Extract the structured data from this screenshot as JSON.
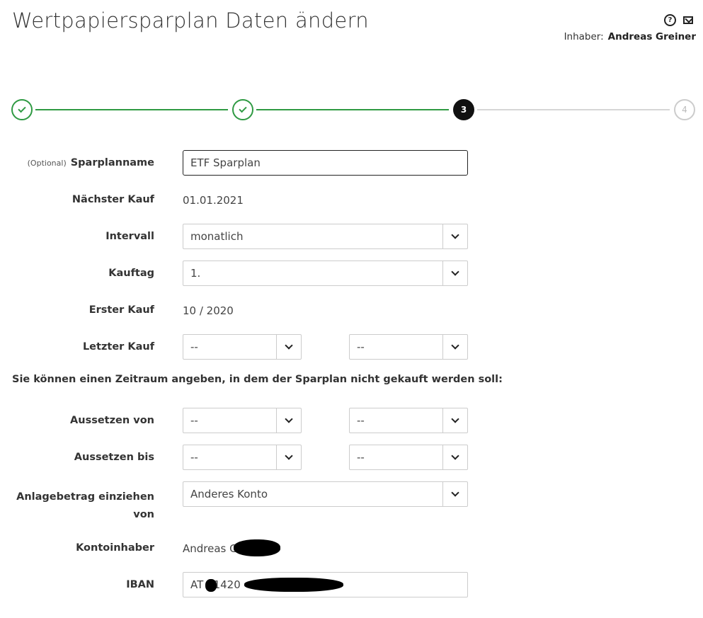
{
  "header": {
    "title": "Wertpapiersparplan Daten ändern",
    "owner_label": "Inhaber:",
    "owner_name": "Andreas Greiner",
    "help_icon_glyph": "?"
  },
  "stepper": {
    "steps": [
      {
        "state": "done",
        "label": ""
      },
      {
        "state": "done",
        "label": ""
      },
      {
        "state": "active",
        "label": "3"
      },
      {
        "state": "todo",
        "label": "4"
      }
    ],
    "colors": {
      "done": "#2f9a43",
      "active": "#111111",
      "todo": "#cccccc"
    }
  },
  "form": {
    "sparplanname": {
      "optional": "(Optional)",
      "label": "Sparplanname",
      "value": "ETF Sparplan"
    },
    "naechster_kauf": {
      "label": "Nächster Kauf",
      "value": "01.01.2021"
    },
    "intervall": {
      "label": "Intervall",
      "value": "monatlich"
    },
    "kauftag": {
      "label": "Kauftag",
      "value": "1."
    },
    "erster_kauf": {
      "label": "Erster Kauf",
      "value": "10 / 2020"
    },
    "letzter_kauf": {
      "label": "Letzter Kauf",
      "month": "--",
      "year": "--"
    },
    "pause_note": "Sie können einen Zeitraum angeben, in dem der Sparplan nicht gekauft werden soll:",
    "aussetzen_von": {
      "label": "Aussetzen von",
      "month": "--",
      "year": "--"
    },
    "aussetzen_bis": {
      "label": "Aussetzen bis",
      "month": "--",
      "year": "--"
    },
    "anlagebetrag": {
      "label_line1": "Anlagebetrag einziehen",
      "label_line2": "von",
      "value": "Anderes Konto"
    },
    "kontoinhaber": {
      "label": "Kontoinhaber",
      "value": "Andreas G"
    },
    "iban": {
      "label": "IBAN",
      "value": "AT   1420"
    }
  }
}
